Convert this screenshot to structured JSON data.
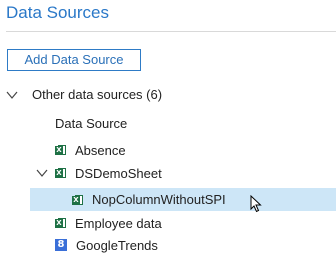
{
  "header": {
    "title": "Data Sources"
  },
  "toolbar": {
    "add_label": "Add Data Source"
  },
  "tree": {
    "group": {
      "label": "Other data sources (6)",
      "expanded": true
    },
    "column_header": "Data Source",
    "items": [
      {
        "label": "Absence",
        "icon": "excel-icon"
      },
      {
        "label": "DSDemoSheet",
        "icon": "excel-icon",
        "expanded": true
      },
      {
        "label": "NopColumnWithoutSPI",
        "icon": "excel-icon",
        "selected": true
      },
      {
        "label": "Employee data",
        "icon": "excel-icon"
      },
      {
        "label": "GoogleTrends",
        "icon": "google-icon"
      }
    ]
  },
  "icons": {
    "excel_letter": "X",
    "google_letter": "8"
  },
  "colors": {
    "title": "#2a78c8",
    "selection": "#cde6f7",
    "excel": "#1e7145",
    "google": "#3a6fd8"
  }
}
